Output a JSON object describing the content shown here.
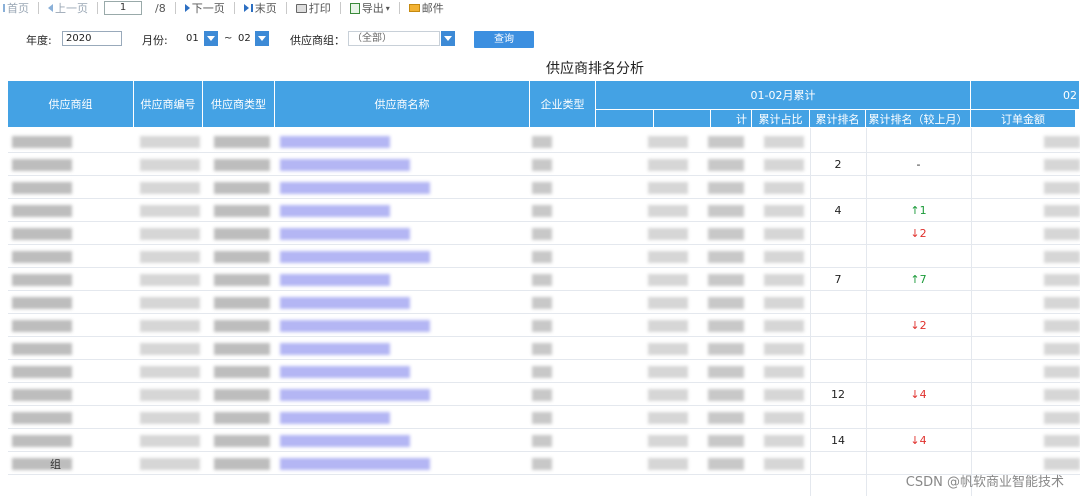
{
  "toolbar": {
    "first": "首页",
    "prev": "上一页",
    "page_value": "1",
    "page_total": "/8",
    "next": "下一页",
    "last": "末页",
    "print": "打印",
    "export": "导出",
    "mail": "邮件"
  },
  "filters": {
    "year_label": "年度:",
    "year_value": "2020",
    "month_label": "月份:",
    "month_from": "01",
    "tilde": "~",
    "month_to": "02",
    "group_label": "供应商组：",
    "group_value": "（全部）",
    "query_button": "查询"
  },
  "report": {
    "title": "供应商排名分析"
  },
  "table": {
    "headers": {
      "group": "供应商组",
      "code": "供应商编号",
      "type": "供应商类型",
      "name": "供应商名称",
      "enterprise_type": "企业类型",
      "period": "01-02月累计",
      "period_next": "02",
      "col_sum": "计",
      "col_share": "累计占比",
      "col_rank": "累计排名",
      "col_rank_change": "累计排名（较上月）",
      "col_order_amount": "订单金额"
    },
    "rows": [
      {
        "rank": "",
        "change": ""
      },
      {
        "rank": "2",
        "change": "-"
      },
      {
        "rank": "",
        "change": ""
      },
      {
        "rank": "4",
        "change": "↑1"
      },
      {
        "rank": "",
        "change": "↓2"
      },
      {
        "rank": "",
        "change": ""
      },
      {
        "rank": "7",
        "change": "↑7"
      },
      {
        "rank": "",
        "change": ""
      },
      {
        "rank": "",
        "change": "↓2"
      },
      {
        "rank": "",
        "change": ""
      },
      {
        "rank": "",
        "change": ""
      },
      {
        "rank": "12",
        "change": "↓4"
      },
      {
        "rank": "",
        "change": ""
      },
      {
        "rank": "14",
        "change": "↓4"
      },
      {
        "rank": "",
        "change": ""
      }
    ],
    "partial_group_text": "组"
  },
  "watermark": "CSDN @帆软商业智能技术"
}
